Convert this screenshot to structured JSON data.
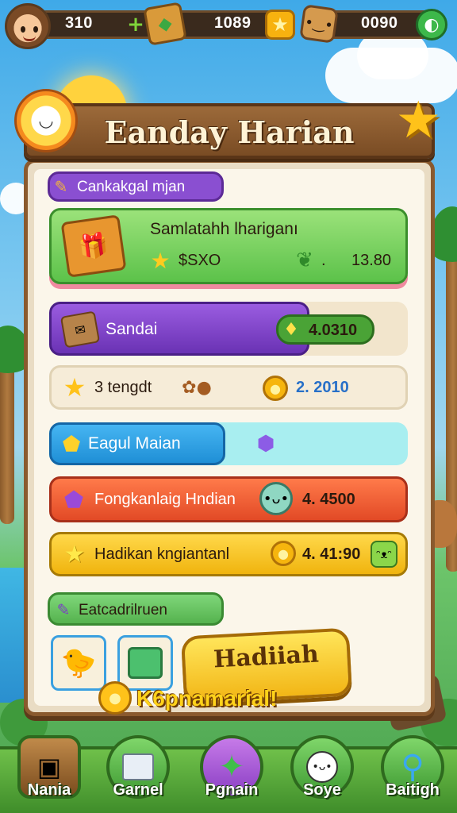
{
  "topbar": {
    "resource_1": "310",
    "resource_2": "1089",
    "resource_3": "0090",
    "icons": [
      "avatar",
      "plus-icon",
      "gem-crate-icon",
      "star-icon",
      "gingerbread-icon",
      "coin-icon"
    ]
  },
  "panel": {
    "title": "Eanday Harian",
    "section_1_label": "Cankakgal mjan",
    "reward_card": {
      "title": "Samlatahh lhariganı",
      "cost_value": "$SXO",
      "amount_value": "13.80"
    },
    "rows": [
      {
        "label": "Sandai",
        "value": "4.0310",
        "color": "#7a3fc4"
      },
      {
        "label": "3 tengdt",
        "value": "2. 2010",
        "color": "#efe3c9"
      },
      {
        "label": "Eagul Maian",
        "value": "",
        "color": "#2c9fe3"
      },
      {
        "label": "Fongkanlaig Hndian",
        "value": "4. 4500",
        "color": "#ef5b34"
      },
      {
        "label": "Hadikan kngiantanl",
        "value": "4. 41:90",
        "color": "#f5c21b"
      }
    ],
    "section_2_label": "Eatcadrilruen",
    "cta_line_1": "Hadiiah",
    "cta_line_2": "K6pnamarial!"
  },
  "nav": {
    "items": [
      {
        "label": "Nania",
        "icon": "treasure-chest-icon"
      },
      {
        "label": "Garnel",
        "icon": "box-stack-icon"
      },
      {
        "label": "Pgnain",
        "icon": "star-compass-icon"
      },
      {
        "label": "Soye",
        "icon": "smile-face-icon"
      },
      {
        "label": "Baitigh",
        "icon": "magnifier-icon"
      }
    ]
  }
}
